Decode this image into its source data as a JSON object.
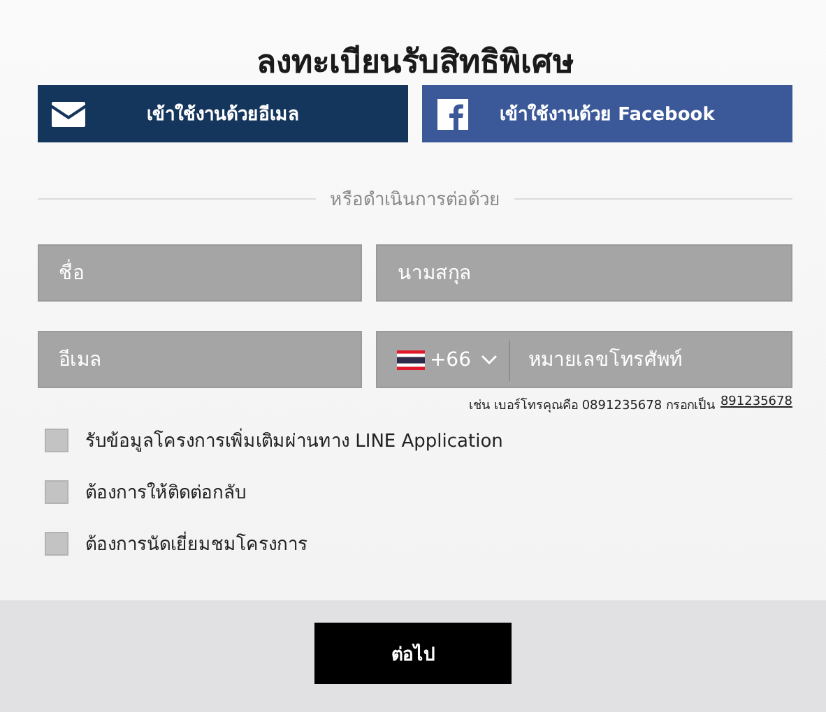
{
  "title": "ลงทะเบียนรับสิทธิพิเศษ",
  "social_buttons": [
    {
      "kind": "email",
      "label": "เข้าใช้งานด้วยอีเมล"
    },
    {
      "kind": "facebook",
      "label": "เข้าใช้งานด้วย Facebook"
    }
  ],
  "divider_text": "หรือดำเนินการต่อด้วย",
  "fields": [
    {
      "placeholder": "ชื่อ"
    },
    {
      "placeholder": "นามสกุล"
    },
    {
      "placeholder": "อีเมล"
    }
  ],
  "phone": {
    "country_code": "+66",
    "placeholder": "หมายเลขโทรศัพท์",
    "hint": "เช่น เบอร์โทรคุณคือ 0891235678 กรอกเป็น",
    "example": "891235678"
  },
  "checkboxes": [
    {
      "label": "รับข้อมูลโครงการเพิ่มเติมผ่านทาง LINE Application",
      "checked": false
    },
    {
      "label": "ต้องการให้ติดต่อกลับ",
      "checked": false
    },
    {
      "label": "ต้องการนัดเยี่ยมชมโครงการ",
      "checked": false
    }
  ],
  "submit": "ต่อไป"
}
